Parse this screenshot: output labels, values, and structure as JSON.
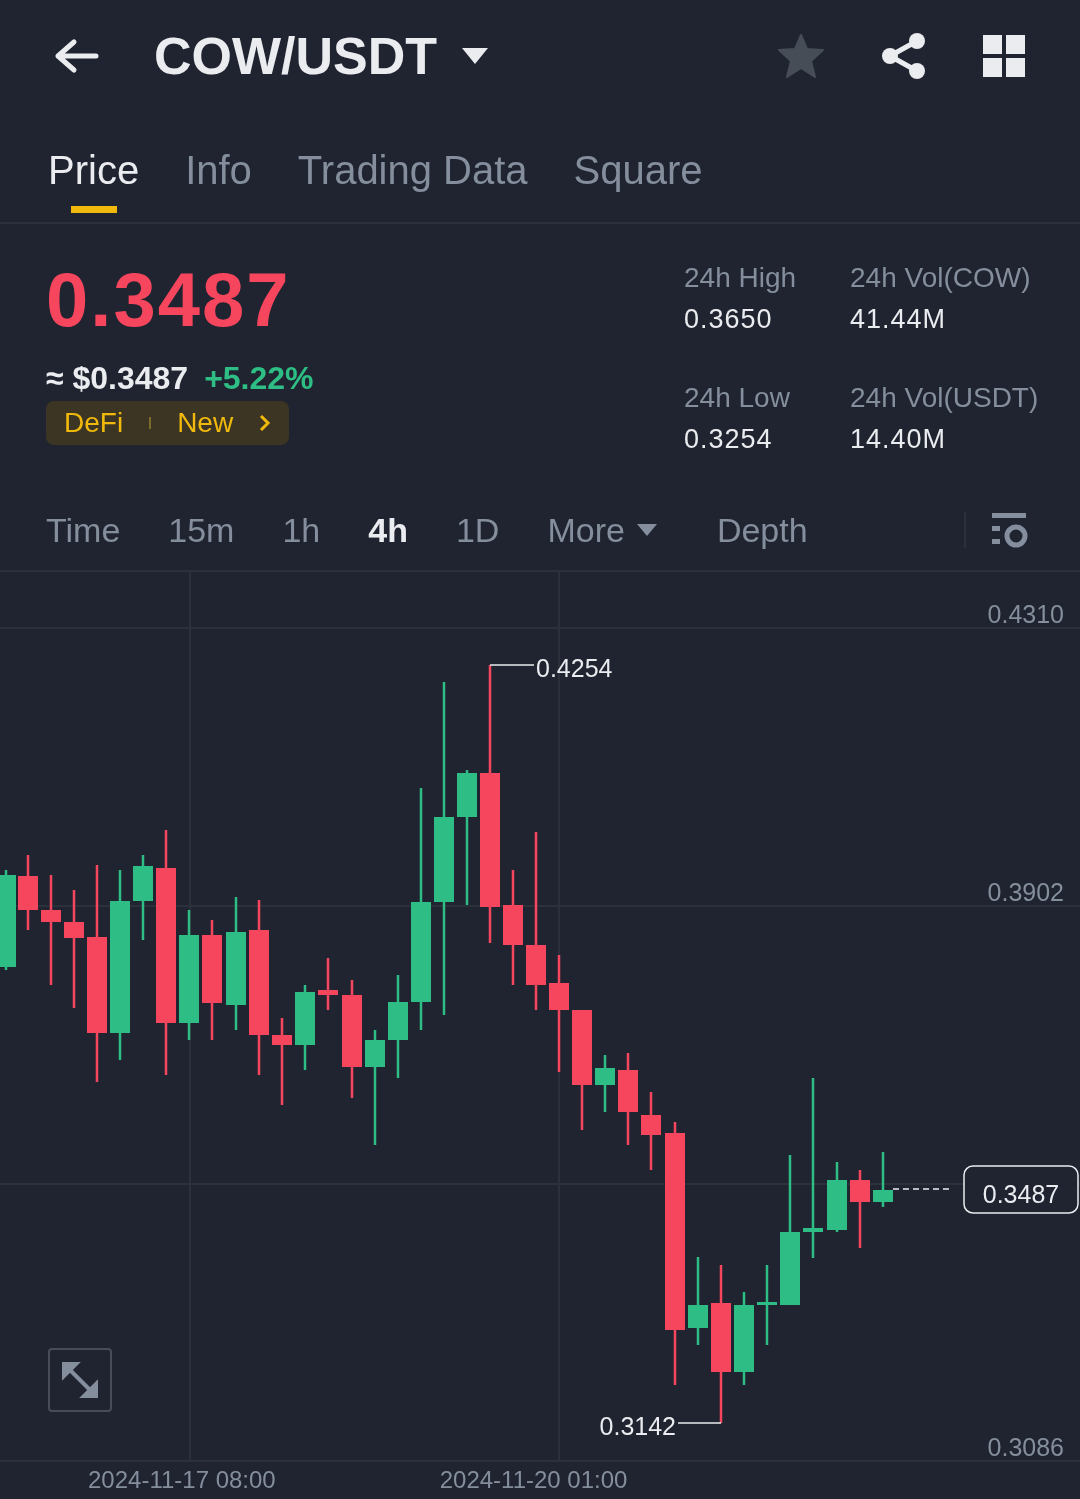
{
  "header": {
    "title": "COW/USDT",
    "favorite": false
  },
  "tabs": [
    {
      "label": "Price",
      "selected": true
    },
    {
      "label": "Info",
      "selected": false
    },
    {
      "label": "Trading Data",
      "selected": false
    },
    {
      "label": "Square",
      "selected": false
    }
  ],
  "price": {
    "last": "0.3487",
    "falling": true,
    "usd": "≈ $0.3487",
    "change": "+5.22%",
    "change_rising": true
  },
  "tags": [
    "DeFi",
    "New"
  ],
  "stats": [
    {
      "label": "24h High",
      "value": "0.3650"
    },
    {
      "label": "24h Vol(COW)",
      "value": "41.44M"
    },
    {
      "label": "24h Low",
      "value": "0.3254"
    },
    {
      "label": "24h Vol(USDT)",
      "value": "14.40M"
    }
  ],
  "intervals": [
    {
      "label": "Time",
      "selected": false
    },
    {
      "label": "15m",
      "selected": false
    },
    {
      "label": "1h",
      "selected": false
    },
    {
      "label": "4h",
      "selected": true
    },
    {
      "label": "1D",
      "selected": false
    }
  ],
  "more": "More",
  "depth": "Depth",
  "chart": {
    "y_labels": [
      "0.4310",
      "0.3902",
      "0.3086"
    ],
    "high_marker": "0.4254",
    "low_marker": "0.3142",
    "current": "0.3487",
    "x_labels": [
      "2024-11-17 08:00",
      "2024-11-20 01:00"
    ]
  }
}
